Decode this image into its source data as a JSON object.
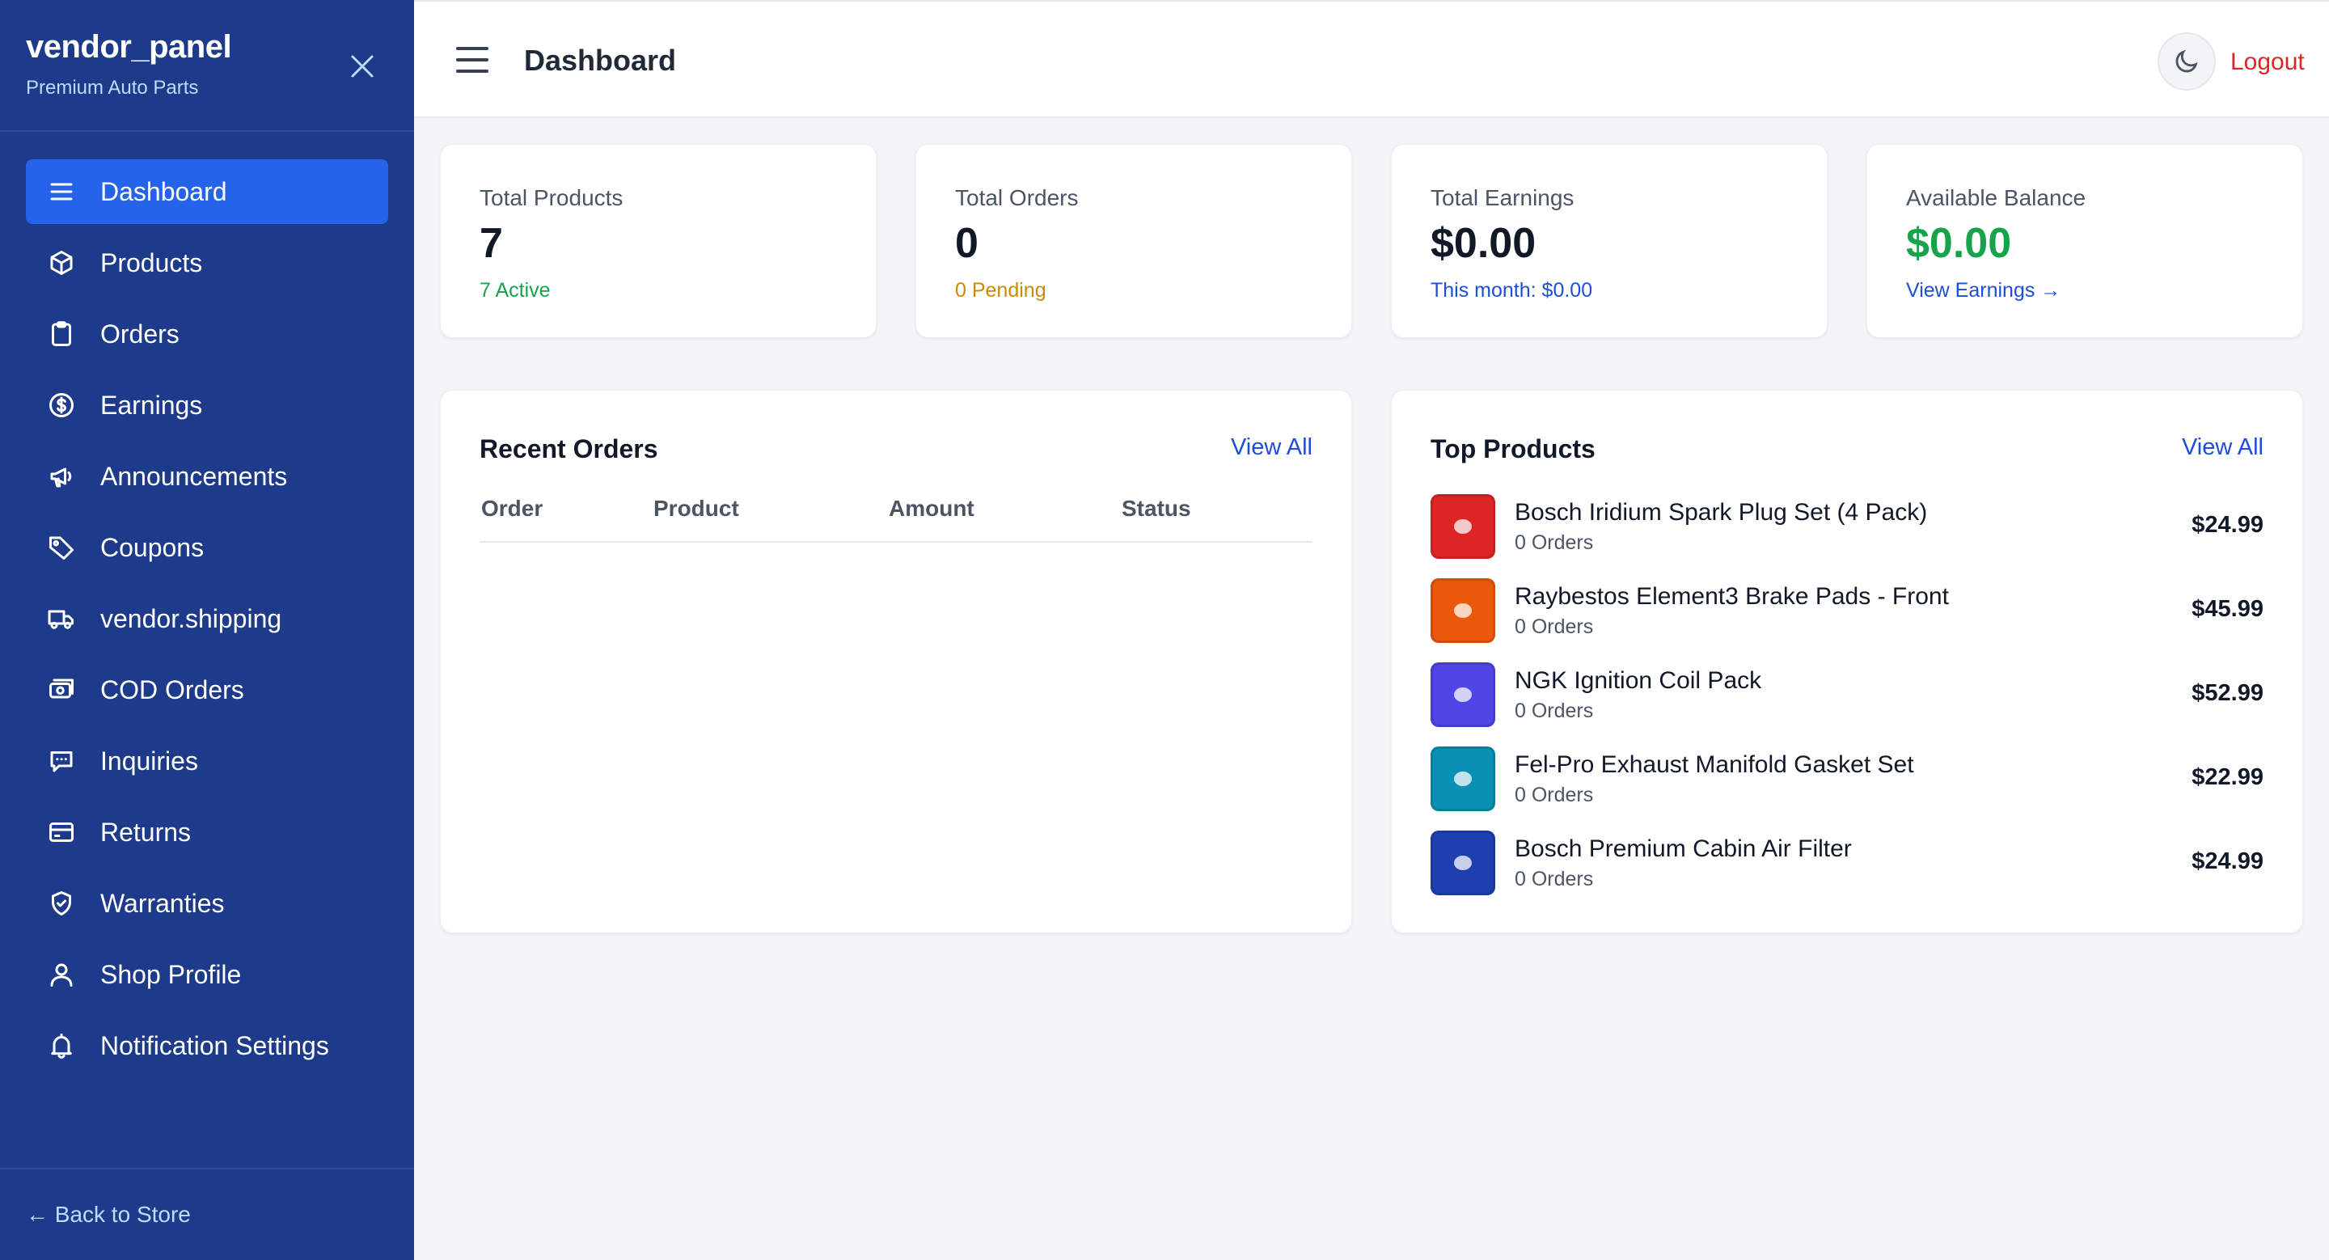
{
  "sidebar": {
    "brand": "vendor_panel",
    "subtitle": "Premium Auto Parts",
    "items": [
      {
        "label": "Dashboard",
        "icon": "menu-icon",
        "active": true
      },
      {
        "label": "Products",
        "icon": "box-icon"
      },
      {
        "label": "Orders",
        "icon": "clipboard-icon"
      },
      {
        "label": "Earnings",
        "icon": "dollar-circle-icon"
      },
      {
        "label": "Announcements",
        "icon": "megaphone-icon"
      },
      {
        "label": "Coupons",
        "icon": "tag-icon"
      },
      {
        "label": "vendor.shipping",
        "icon": "truck-icon"
      },
      {
        "label": "COD Orders",
        "icon": "cash-icon"
      },
      {
        "label": "Inquiries",
        "icon": "chat-icon"
      },
      {
        "label": "Returns",
        "icon": "card-icon"
      },
      {
        "label": "Warranties",
        "icon": "shield-check-icon"
      },
      {
        "label": "Shop Profile",
        "icon": "user-icon"
      },
      {
        "label": "Notification Settings",
        "icon": "bell-icon"
      }
    ],
    "back_link": "← Back to Store"
  },
  "header": {
    "title": "Dashboard",
    "logout": "Logout"
  },
  "stats": [
    {
      "label": "Total Products",
      "value": "7",
      "sub": "7 Active"
    },
    {
      "label": "Total Orders",
      "value": "0",
      "sub": "0 Pending"
    },
    {
      "label": "Total Earnings",
      "value": "$0.00",
      "sub": "This month: $0.00"
    },
    {
      "label": "Available Balance",
      "value": "$0.00",
      "sub": "View Earnings →"
    }
  ],
  "recent_orders": {
    "title": "Recent Orders",
    "view_all": "View All",
    "columns": [
      "Order",
      "Product",
      "Amount",
      "Status"
    ],
    "rows": []
  },
  "top_products": {
    "title": "Top Products",
    "view_all": "View All",
    "items": [
      {
        "name": "Bosch Iridium Spark Plug Set (4 Pack)",
        "orders": "0 Orders",
        "price": "$24.99",
        "color": "#dc2626"
      },
      {
        "name": "Raybestos Element3 Brake Pads - Front",
        "orders": "0 Orders",
        "price": "$45.99",
        "color": "#ea580c"
      },
      {
        "name": "NGK Ignition Coil Pack",
        "orders": "0 Orders",
        "price": "$52.99",
        "color": "#4f46e5"
      },
      {
        "name": "Fel-Pro Exhaust Manifold Gasket Set",
        "orders": "0 Orders",
        "price": "$22.99",
        "color": "#0891b2"
      },
      {
        "name": "Bosch Premium Cabin Air Filter",
        "orders": "0 Orders",
        "price": "$24.99",
        "color": "#1e40af"
      }
    ]
  }
}
